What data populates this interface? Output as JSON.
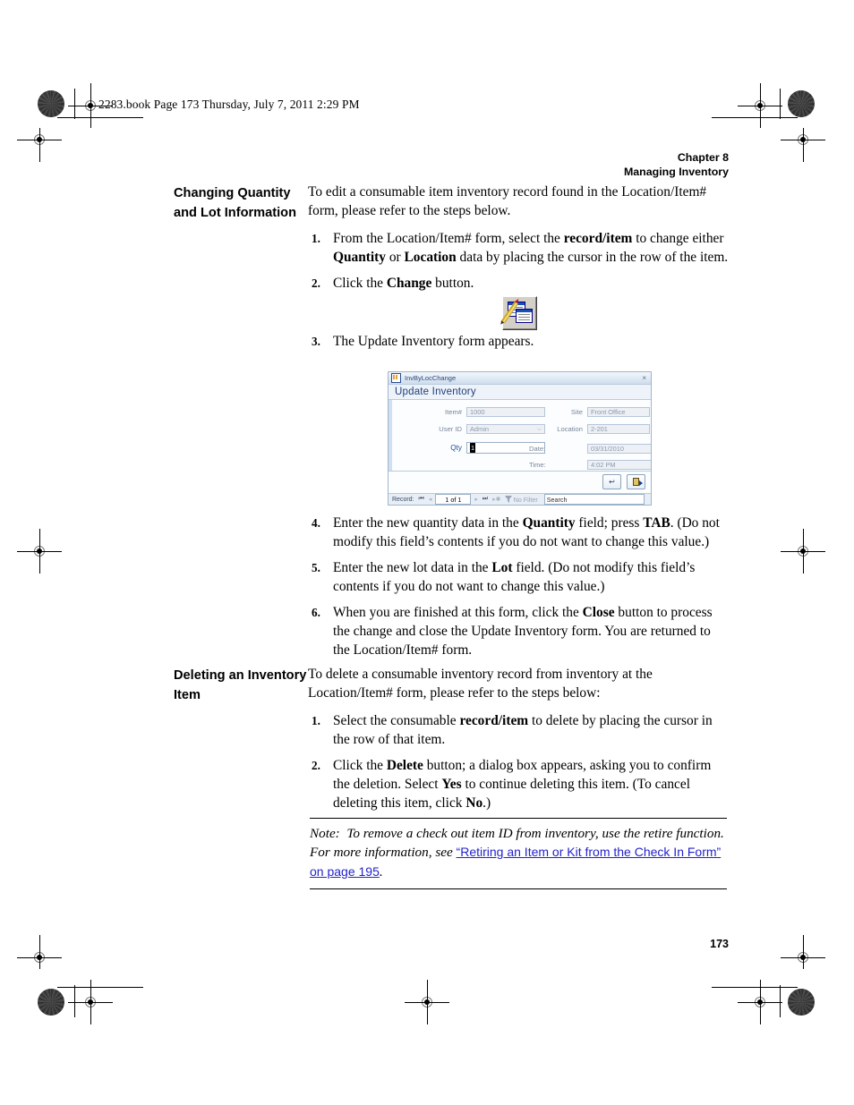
{
  "page": {
    "slugline": "2283.book  Page 173  Thursday, July 7, 2011  2:29 PM",
    "folio": "173"
  },
  "running_head": {
    "chapter": "Chapter 8",
    "title": "Managing Inventory"
  },
  "sections": [
    {
      "heading": "Changing Quantity and Lot Information",
      "intro": "To edit a consumable item inventory record found in the Location/Item# form, please refer to the steps below.",
      "steps_before_figure": [
        {
          "number": "1.",
          "parts": [
            {
              "t": "From the Location/Item# form, select the ",
              "b": false
            },
            {
              "t": "record/item",
              "b": true
            },
            {
              "t": " to change either ",
              "b": false
            },
            {
              "t": "Quantity",
              "b": true
            },
            {
              "t": " or ",
              "b": false
            },
            {
              "t": "Location",
              "b": true
            },
            {
              "t": " data by placing the cursor in the row of the item.",
              "b": false
            }
          ]
        },
        {
          "number": "2.",
          "parts": [
            {
              "t": "Click the ",
              "b": false
            },
            {
              "t": "Change",
              "b": true
            },
            {
              "t": " button.",
              "b": false
            }
          ]
        }
      ],
      "figure_caption_step": {
        "number": "3.",
        "parts": [
          {
            "t": "The Update Inventory form appears.",
            "b": false
          }
        ]
      },
      "steps_after_figure": [
        {
          "number": "4.",
          "parts": [
            {
              "t": "Enter the new quantity data in the ",
              "b": false
            },
            {
              "t": "Quantity",
              "b": true
            },
            {
              "t": " field; press ",
              "b": false
            },
            {
              "t": "TAB",
              "b": true
            },
            {
              "t": ". (Do not modify this field’s contents if you do not want to change this value.)",
              "b": false
            }
          ]
        },
        {
          "number": "5.",
          "parts": [
            {
              "t": "Enter the new lot data in the ",
              "b": false
            },
            {
              "t": "Lot",
              "b": true
            },
            {
              "t": " field. (Do not modify this field’s contents if you do not want to change this value.)",
              "b": false
            }
          ]
        },
        {
          "number": "6.",
          "parts": [
            {
              "t": "When you are finished at this form, click the ",
              "b": false
            },
            {
              "t": "Close",
              "b": true
            },
            {
              "t": " button to process the change and close the Update Inventory form. You are returned to the Location/Item# form.",
              "b": false
            }
          ]
        }
      ]
    },
    {
      "heading": "Deleting an Inventory Item",
      "intro": "To delete a consumable inventory record from inventory at the Location/Item# form, please refer to the steps below:",
      "steps": [
        {
          "number": "1.",
          "parts": [
            {
              "t": "Select the consumable ",
              "b": false
            },
            {
              "t": "record/item",
              "b": true
            },
            {
              "t": " to delete by placing the cursor in the row of that item.",
              "b": false
            }
          ]
        },
        {
          "number": "2.",
          "parts": [
            {
              "t": "Click the ",
              "b": false
            },
            {
              "t": "Delete",
              "b": true
            },
            {
              "t": " button; a dialog box appears, asking you to confirm the deletion. Select ",
              "b": false
            },
            {
              "t": "Yes",
              "b": true
            },
            {
              "t": " to continue deleting this item. (To cancel deleting this item, click ",
              "b": false
            },
            {
              "t": "No",
              "b": true
            },
            {
              "t": ".)",
              "b": false
            }
          ]
        }
      ]
    }
  ],
  "change_button_icon": {
    "name": "change-form-icon",
    "label": "Change"
  },
  "screenshot": {
    "window_title": "InvByLocChange",
    "close_glyph": "×",
    "form_header": "Update Inventory",
    "fields": {
      "item_number": {
        "label": "Item#",
        "value": "1000"
      },
      "user_id": {
        "label": "User ID",
        "value": "Admin",
        "dropdown_glyph": "⌵"
      },
      "qty": {
        "label": "Qty",
        "value": "1",
        "selected": true
      },
      "site": {
        "label": "Site",
        "value": "Front Office"
      },
      "location": {
        "label": "Location",
        "value": "2-201"
      },
      "date": {
        "label": "Date:",
        "value": "03/31/2010"
      },
      "time": {
        "label": "Time:",
        "value": "4:02 PM"
      }
    },
    "buttons": {
      "undo": "↩",
      "close": "exit-door-icon"
    },
    "navbar": {
      "record_label": "Record:",
      "first": "⏮",
      "previous": "◂",
      "position": "1 of 1",
      "next": "▸",
      "last": "⏭",
      "new_record": "▸✱",
      "filter_icon": "filter-icon",
      "filter_label": "No Filter",
      "search_placeholder": "Search"
    }
  },
  "note": {
    "label": "Note:",
    "text_before": "To remove a check out item ID from inventory, use the retire function. For more information, see ",
    "link_text": "“Retiring an Item or Kit from the Check In Form” on page 195",
    "text_after": "."
  },
  "colors": {
    "link": "#2222cc",
    "form_header_text": "#1f3f7a",
    "field_text": "#8c98a8"
  }
}
